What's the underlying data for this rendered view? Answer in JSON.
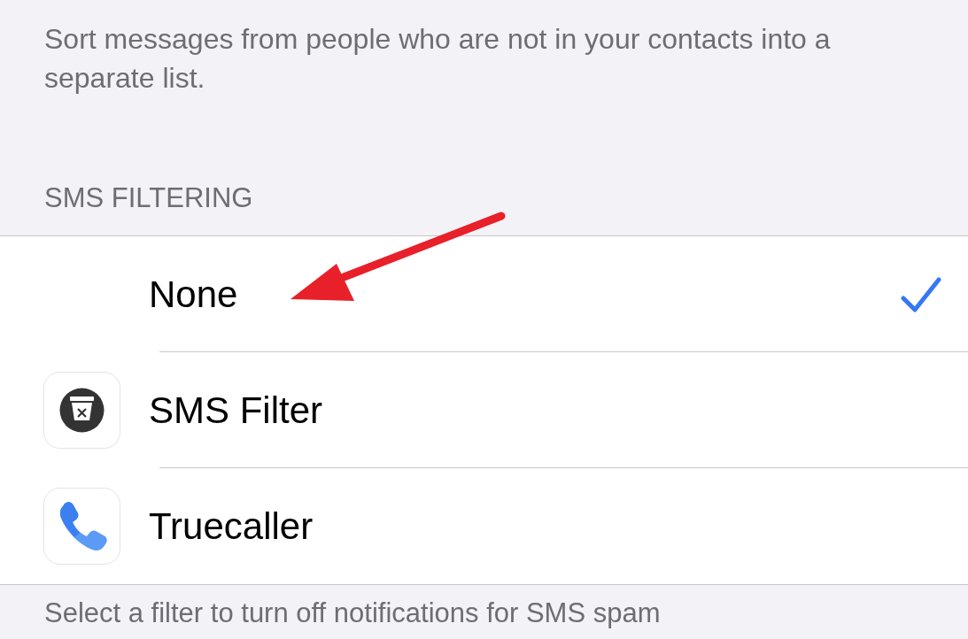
{
  "description": "Sort messages from people who are not in your contacts into a separate list.",
  "section_header": "SMS FILTERING",
  "options": [
    {
      "label": "None",
      "kind": "plain",
      "selected": true
    },
    {
      "label": "SMS Filter",
      "kind": "app",
      "selected": false
    },
    {
      "label": "Truecaller",
      "kind": "app",
      "selected": false
    }
  ],
  "callout": {
    "kind": "arrow"
  },
  "footer": "Select a filter to turn off notifications for SMS spam"
}
